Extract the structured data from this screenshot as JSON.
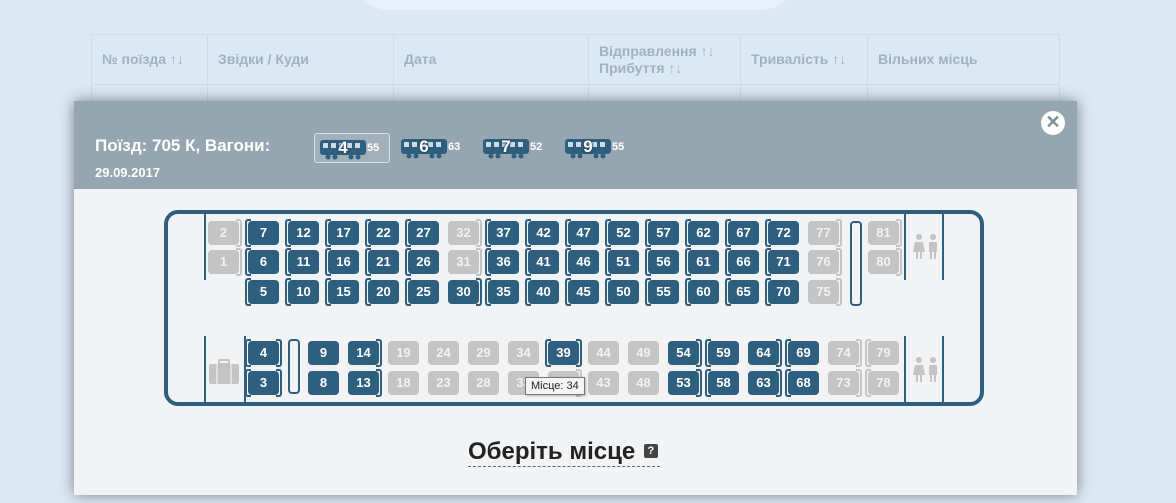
{
  "table": {
    "headers": [
      "№ поїзда ↑↓",
      "Звідки / Куди",
      "Дата",
      "Відправлення ↑↓",
      "Прибуття ↑↓",
      "Тривалість ↑↓",
      "Вільних місць"
    ]
  },
  "modal": {
    "train_line": "Поїзд: 705 К, Вагони:",
    "date": "29.09.2017",
    "close_glyph": "✕",
    "wagons": [
      {
        "number": "4",
        "free": "55",
        "active": true
      },
      {
        "number": "6",
        "free": "63",
        "active": false
      },
      {
        "number": "7",
        "free": "52",
        "active": false
      },
      {
        "number": "9",
        "free": "55",
        "active": false
      }
    ],
    "tooltip": "Місце: 34",
    "choose_label": "Оберіть місце",
    "help_glyph": "?"
  },
  "seats": {
    "free": [
      "3",
      "4",
      "5",
      "6",
      "7",
      "8",
      "9",
      "10",
      "11",
      "12",
      "13",
      "14",
      "15",
      "16",
      "17",
      "20",
      "21",
      "22",
      "25",
      "26",
      "27",
      "30",
      "35",
      "36",
      "37",
      "39",
      "40",
      "41",
      "42",
      "45",
      "46",
      "47",
      "50",
      "51",
      "52",
      "53",
      "54",
      "55",
      "56",
      "57",
      "58",
      "59",
      "60",
      "61",
      "62",
      "63",
      "64",
      "65",
      "66",
      "67",
      "68",
      "69",
      "70",
      "71",
      "72"
    ],
    "taken": [
      "1",
      "2",
      "18",
      "19",
      "23",
      "24",
      "28",
      "29",
      "31",
      "32",
      "33",
      "34",
      "38",
      "43",
      "44",
      "48",
      "49",
      "73",
      "74",
      "75",
      "76",
      "77",
      "78",
      "79",
      "80",
      "81"
    ]
  },
  "colors": {
    "free_seat": "#2e5f7f",
    "taken_seat": "#c4c4c4",
    "header_bg": "#96a6b0"
  }
}
